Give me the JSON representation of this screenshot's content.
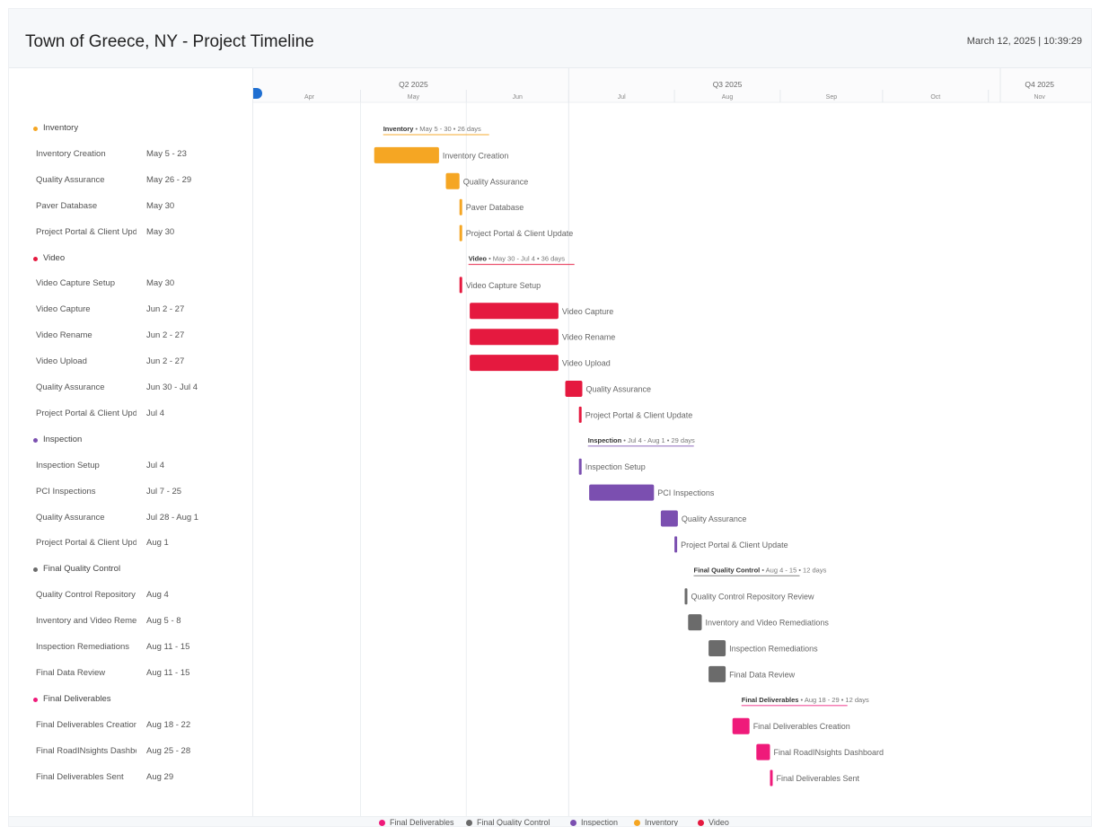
{
  "header": {
    "title": "Town of Greece, NY - Project Timeline",
    "datetime": "March 12, 2025 | 10:39:29"
  },
  "colors": {
    "Inventory": "#f5a623",
    "Video": "#e5193f",
    "Inspection": "#7b4fb0",
    "Final Quality Control": "#6b6b6b",
    "Final Deliverables": "#ef1a7a"
  },
  "chart_data": {
    "type": "gantt",
    "year": 2025,
    "quarters": [
      {
        "label": "Q2 2025",
        "month": 5
      },
      {
        "label": "Q3 2025",
        "month": 8
      },
      {
        "label": "Q4 2025",
        "month": 11
      }
    ],
    "months": [
      "Apr",
      "May",
      "Jun",
      "Jul",
      "Aug",
      "Sep",
      "Oct",
      "Nov"
    ],
    "rows": [
      {
        "kind": "group",
        "group": "Inventory",
        "name": "Inventory",
        "summary_title": "Inventory",
        "summary_text": " • May 5 - 30 • 26 days",
        "start": "2025-05-05",
        "end": "2025-05-30"
      },
      {
        "kind": "task",
        "group": "Inventory",
        "name": "Inventory Creation",
        "date_label": "May 5 - 23",
        "start": "2025-05-05",
        "end": "2025-05-23"
      },
      {
        "kind": "task",
        "group": "Inventory",
        "name": "Quality Assurance",
        "date_label": "May 26 - 29",
        "start": "2025-05-26",
        "end": "2025-05-29"
      },
      {
        "kind": "task",
        "group": "Inventory",
        "name": "Paver Database",
        "date_label": "May 30",
        "start": "2025-05-30",
        "end": "2025-05-30"
      },
      {
        "kind": "task",
        "group": "Inventory",
        "name": "Project Portal & Client Update",
        "list_name": "Project Portal & Client Upd",
        "date_label": "May 30",
        "start": "2025-05-30",
        "end": "2025-05-30"
      },
      {
        "kind": "group",
        "group": "Video",
        "name": "Video",
        "summary_title": "Video",
        "summary_text": " • May 30 - Jul 4 • 36 days",
        "start": "2025-05-30",
        "end": "2025-07-04"
      },
      {
        "kind": "task",
        "group": "Video",
        "name": "Video Capture Setup",
        "date_label": "May 30",
        "start": "2025-05-30",
        "end": "2025-05-30"
      },
      {
        "kind": "task",
        "group": "Video",
        "name": "Video Capture",
        "date_label": "Jun 2 - 27",
        "start": "2025-06-02",
        "end": "2025-06-27"
      },
      {
        "kind": "task",
        "group": "Video",
        "name": "Video Rename",
        "date_label": "Jun 2 - 27",
        "start": "2025-06-02",
        "end": "2025-06-27"
      },
      {
        "kind": "task",
        "group": "Video",
        "name": "Video Upload",
        "date_label": "Jun 2 - 27",
        "start": "2025-06-02",
        "end": "2025-06-27"
      },
      {
        "kind": "task",
        "group": "Video",
        "name": "Quality Assurance",
        "date_label": "Jun 30 - Jul 4",
        "start": "2025-06-30",
        "end": "2025-07-04"
      },
      {
        "kind": "task",
        "group": "Video",
        "name": "Project Portal & Client Update",
        "list_name": "Project Portal & Client Upd",
        "date_label": "Jul 4",
        "start": "2025-07-04",
        "end": "2025-07-04"
      },
      {
        "kind": "group",
        "group": "Inspection",
        "name": "Inspection",
        "summary_title": "Inspection",
        "summary_text": " • Jul 4 - Aug 1 • 29 days",
        "start": "2025-07-04",
        "end": "2025-08-01"
      },
      {
        "kind": "task",
        "group": "Inspection",
        "name": "Inspection Setup",
        "date_label": "Jul 4",
        "start": "2025-07-04",
        "end": "2025-07-04"
      },
      {
        "kind": "task",
        "group": "Inspection",
        "name": "PCI Inspections",
        "date_label": "Jul 7 - 25",
        "start": "2025-07-07",
        "end": "2025-07-25"
      },
      {
        "kind": "task",
        "group": "Inspection",
        "name": "Quality Assurance",
        "date_label": "Jul 28 - Aug 1",
        "start": "2025-07-28",
        "end": "2025-08-01"
      },
      {
        "kind": "task",
        "group": "Inspection",
        "name": "Project Portal & Client Update",
        "list_name": "Project Portal & Client Upd",
        "date_label": "Aug 1",
        "start": "2025-08-01",
        "end": "2025-08-01"
      },
      {
        "kind": "group",
        "group": "Final Quality Control",
        "name": "Final Quality Control",
        "summary_title": "Final Quality Control",
        "summary_text": " • Aug 4 - 15 • 12 days",
        "start": "2025-08-04",
        "end": "2025-08-15"
      },
      {
        "kind": "task",
        "group": "Final Quality Control",
        "name": "Quality Control Repository Review",
        "list_name": "Quality Control Repository",
        "date_label": "Aug 4",
        "start": "2025-08-04",
        "end": "2025-08-04"
      },
      {
        "kind": "task",
        "group": "Final Quality Control",
        "name": "Inventory and Video Remediations",
        "list_name": "Inventory and Video Reme",
        "date_label": "Aug 5 - 8",
        "start": "2025-08-05",
        "end": "2025-08-08"
      },
      {
        "kind": "task",
        "group": "Final Quality Control",
        "name": "Inspection Remediations",
        "date_label": "Aug 11 - 15",
        "start": "2025-08-11",
        "end": "2025-08-15"
      },
      {
        "kind": "task",
        "group": "Final Quality Control",
        "name": "Final Data Review",
        "date_label": "Aug 11 - 15",
        "start": "2025-08-11",
        "end": "2025-08-15"
      },
      {
        "kind": "group",
        "group": "Final Deliverables",
        "name": "Final Deliverables",
        "summary_title": "Final Deliverables",
        "summary_text": " • Aug 18 - 29 • 12 days",
        "start": "2025-08-18",
        "end": "2025-08-29"
      },
      {
        "kind": "task",
        "group": "Final Deliverables",
        "name": "Final Deliverables Creation",
        "list_name": "Final Deliverables Creation",
        "date_label": "Aug 18 - 22",
        "start": "2025-08-18",
        "end": "2025-08-22"
      },
      {
        "kind": "task",
        "group": "Final Deliverables",
        "name": "Final RoadINsights Dashboard",
        "list_name": "Final RoadINsights Dashbo",
        "date_label": "Aug 25 - 28",
        "start": "2025-08-25",
        "end": "2025-08-28"
      },
      {
        "kind": "task",
        "group": "Final Deliverables",
        "name": "Final Deliverables Sent",
        "date_label": "Aug 29",
        "start": "2025-08-29",
        "end": "2025-08-29"
      }
    ],
    "legend": [
      "Final Deliverables",
      "Final Quality Control",
      "Inspection",
      "Inventory",
      "Video"
    ],
    "legend_placement": "bottom",
    "grid": true
  }
}
